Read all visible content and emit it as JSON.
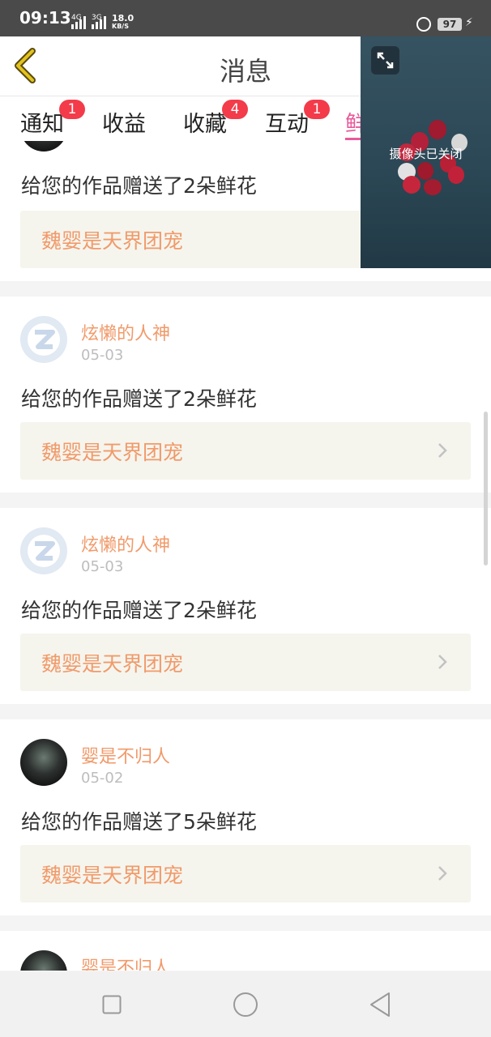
{
  "status_bar": {
    "time": "09:13",
    "net1": "4G",
    "net2": "3G",
    "speed": "18.0",
    "speed_unit": "KB/S",
    "battery": "97"
  },
  "header": {
    "title": "消息",
    "back_icon": "chevron-left-icon"
  },
  "tabs": [
    {
      "label": "通知",
      "badge": "1"
    },
    {
      "label": "收益",
      "badge": ""
    },
    {
      "label": "收藏",
      "badge": "4"
    },
    {
      "label": "互动",
      "badge": "1"
    },
    {
      "label": "鲜花",
      "badge": "",
      "active": true
    }
  ],
  "camera_overlay": {
    "text": "摄像头已关闭",
    "expand_icon": "expand-icon"
  },
  "messages": [
    {
      "user": "",
      "date": "",
      "text": "给您的作品赠送了2朵鲜花",
      "work": "魏婴是天界团宠",
      "avatar": "photo"
    },
    {
      "user": "炫懒的人神",
      "date": "05-03",
      "text": "给您的作品赠送了2朵鲜花",
      "work": "魏婴是天界团宠",
      "avatar": "default"
    },
    {
      "user": "炫懒的人神",
      "date": "05-03",
      "text": "给您的作品赠送了2朵鲜花",
      "work": "魏婴是天界团宠",
      "avatar": "default"
    },
    {
      "user": "婴是不归人",
      "date": "05-02",
      "text": "给您的作品赠送了5朵鲜花",
      "work": "魏婴是天界团宠",
      "avatar": "photo"
    },
    {
      "user": "婴是不归人",
      "date": "",
      "text": "",
      "work": "",
      "avatar": "photo"
    }
  ],
  "colors": {
    "accent_orange": "#f19a6a",
    "badge_red": "#f33b4a",
    "active_tab_pink": "#e85a9a",
    "back_arrow": "#e3c21e"
  },
  "nav_bar": {
    "icons": [
      "square-icon",
      "circle-icon",
      "triangle-back-icon"
    ]
  }
}
